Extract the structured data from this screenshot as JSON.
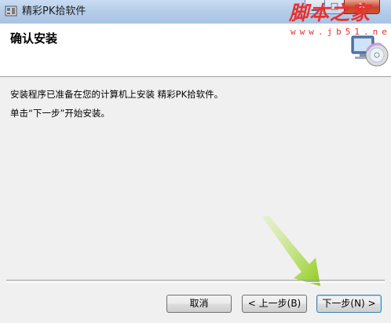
{
  "window": {
    "title": "精彩PK拾软件"
  },
  "watermark": {
    "main": "脚本之家",
    "sub": "www.jb51.net"
  },
  "header": {
    "title": "确认安装"
  },
  "content": {
    "line1": "安装程序已准备在您的计算机上安装 精彩PK拾软件。",
    "line2": "单击“下一步”开始安装。"
  },
  "buttons": {
    "cancel": "取消",
    "back": "< 上一步(B)",
    "next": "下一步(N) >"
  },
  "colors": {
    "accent_arrow": "#9ad32a",
    "watermark": "#e8312f"
  },
  "icons": {
    "app": "installer-app-icon",
    "setup": "computer-cd-icon"
  }
}
